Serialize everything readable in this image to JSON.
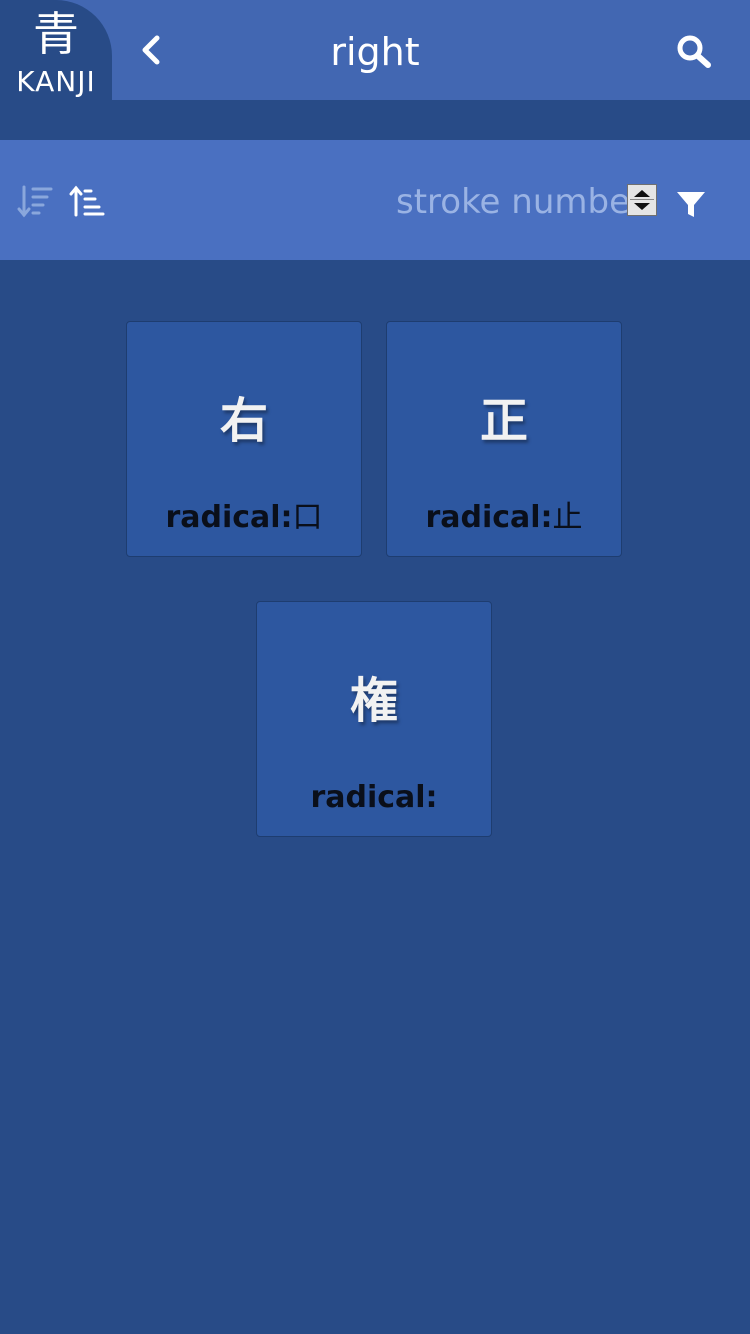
{
  "header": {
    "logo_kanji": "青",
    "logo_text": "KANJI",
    "title": "right"
  },
  "toolbar": {
    "sort_label": "stroke number"
  },
  "results": [
    {
      "kanji": "右",
      "radical_label": "radical:",
      "radical": "口"
    },
    {
      "kanji": "正",
      "radical_label": "radical:",
      "radical": "止"
    },
    {
      "kanji": "権",
      "radical_label": "radical:",
      "radical": ""
    }
  ],
  "icons": {
    "back": "chevron-left-icon",
    "search": "search-icon",
    "sort_desc": "sort-descending-icon",
    "sort_asc": "sort-ascending-icon",
    "filter": "filter-icon"
  },
  "colors": {
    "header": "#4267b2",
    "toolbar": "#4a70c1",
    "background": "#284b87",
    "card": "#2d57a0"
  }
}
